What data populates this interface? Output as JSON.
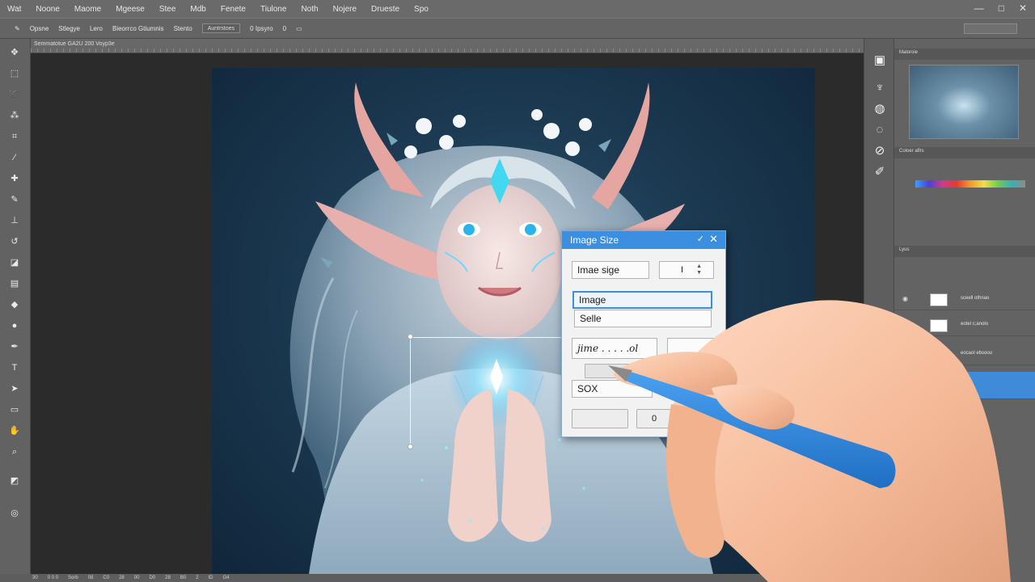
{
  "menubar": {
    "items": [
      "Wat",
      "Noone",
      "Maome",
      "Mgeese",
      "Stee",
      "Mdb",
      "Fenete",
      "Tiulone",
      "Noth",
      "Nojere",
      "Drueste",
      "Spo"
    ],
    "window_controls": [
      "—",
      "□",
      "✕"
    ]
  },
  "optionsbar": {
    "items": [
      "Opsne",
      "Stlegye",
      "Lero",
      "Bieorrco Gtiumnis",
      "Stento"
    ],
    "box1": "Auntrstoes",
    "box2": "0 Ipsyro",
    "value": "0"
  },
  "document": {
    "tab_label": "Semmatotue GA2U 200 Voyp3e"
  },
  "statusbar": {
    "items": [
      "30",
      "0 0 0",
      "Sorb",
      "08",
      "C0",
      "28",
      "00",
      "D0",
      "28",
      "B0",
      "2",
      "ID",
      "G4"
    ]
  },
  "panels": {
    "navigator_label": "Maloroie",
    "color_label": "Coloer aflrs",
    "layers_label": "Lyus",
    "layers": [
      {
        "name": "sceell othnao"
      },
      {
        "name": "eotel c;anolo"
      },
      {
        "name": "eocaol ebsoou"
      }
    ]
  },
  "dialog": {
    "title": "Image Size",
    "image_size_label": "Imae sige",
    "stepper_value": "I",
    "field_image": "Image",
    "field_selle": "Selle",
    "handwritten_field": "jime . . . . .ol",
    "field_sox": "SOX",
    "ok_label": "0"
  },
  "colors": {
    "accent": "#3c8ee0",
    "layer_selected": "#3f8bd9",
    "canvas_bg": "#2b2b2b",
    "ui_gray": "#646464",
    "pen": "#2f86e0"
  },
  "icons": {
    "tools": [
      "move-icon",
      "marquee-icon",
      "lasso-icon",
      "magic-wand-icon",
      "crop-icon",
      "eyedropper-icon",
      "healing-icon",
      "brush-icon",
      "stamp-icon",
      "history-brush-icon",
      "eraser-icon",
      "gradient-icon",
      "blur-icon",
      "dodge-icon",
      "pen-icon",
      "type-icon",
      "path-select-icon",
      "shape-icon",
      "hand-icon",
      "zoom-icon"
    ],
    "right_strip": [
      "save-icon",
      "swatch-icon",
      "adjust-icon",
      "history-icon",
      "paths-icon",
      "brush-settings-icon"
    ]
  }
}
